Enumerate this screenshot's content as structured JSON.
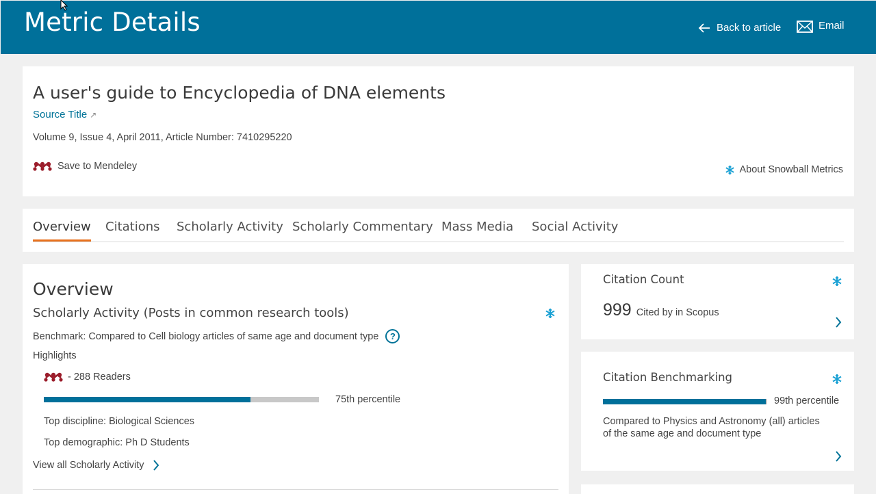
{
  "header": {
    "title": "Metric Details",
    "back_label": "Back to article",
    "email_label": "Email"
  },
  "article": {
    "title": "A user's guide to Encyclopedia of DNA elements",
    "source_title": "Source Title",
    "source_ext_glyph": "↗",
    "meta": "Volume 9, Issue 4, April 2011, Article Number: 7410295220",
    "mendeley_label": "Save to Mendeley",
    "about_label": "About Snowball Metrics"
  },
  "tabs": [
    {
      "label": "Overview",
      "active": true
    },
    {
      "label": "Citations",
      "active": false
    },
    {
      "label": "Scholarly Activity",
      "active": false
    },
    {
      "label": "Scholarly Commentary",
      "active": false
    },
    {
      "label": "Mass Media",
      "active": false
    },
    {
      "label": "Social Activity",
      "active": false
    }
  ],
  "overview": {
    "heading": "Overview",
    "subtitle": "Scholarly Activity (Posts in common research tools)",
    "benchmark": "Benchmark: Compared to Cell biology articles of same age and document type",
    "highlights_label": "Highlights",
    "readers": "- 288 Readers",
    "percentile_label": "75th percentile",
    "percentile_value": 0.75,
    "top_discipline": "Top discipline: Biological Sciences",
    "top_demographic": "Top demographic: Ph D Students",
    "view_all": "View all Scholarly Activity"
  },
  "citation_count": {
    "title": "Citation Count",
    "count": "999",
    "label": "Cited by in Scopus"
  },
  "citation_benchmarking": {
    "title": "Citation Benchmarking",
    "percentile_label": "99th percentile",
    "percentile_value": 0.99,
    "compared_line1": "Compared to Physics and Astronomy (all) articles",
    "compared_line2": "of the same age and document type"
  },
  "colors": {
    "header": "#00709a",
    "accent": "#007398",
    "tab_underline": "#e9711c",
    "mendeley": "#9b1d2b",
    "snowball": "#1ba1d4"
  }
}
